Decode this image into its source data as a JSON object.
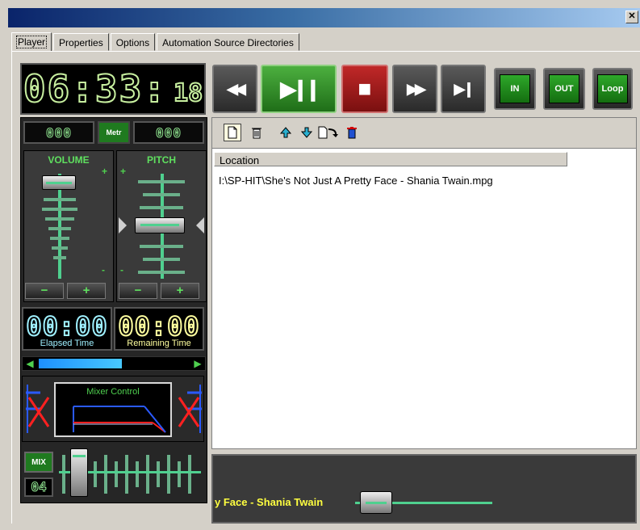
{
  "window": {
    "close_glyph": "✕"
  },
  "tabs": [
    {
      "label": "Player",
      "active": true
    },
    {
      "label": "Properties"
    },
    {
      "label": "Options"
    },
    {
      "label": "Automation Source Directories"
    }
  ],
  "clock": {
    "main": "06:33:",
    "seconds": "18"
  },
  "transport": {
    "rewind": "◀◀",
    "play_pause": "▶❙❙",
    "stop": "■",
    "forward": "▶▶",
    "next": "▶❙",
    "in_label": "IN",
    "out_label": "OUT",
    "loop_label": "Loop"
  },
  "controls": {
    "left_lcd": "000",
    "right_lcd": "000",
    "metr_label": "Metr",
    "volume_label": "VOLUME",
    "pitch_label": "PITCH",
    "volume_minus": "−",
    "volume_plus": "+",
    "pitch_minus": "−",
    "pitch_plus": "+",
    "scale_plus": "+",
    "scale_minus": "-"
  },
  "times": {
    "elapsed_value": "00:00",
    "elapsed_label": "Elapsed Time",
    "remaining_value": "00:00",
    "remaining_label": "Remaining Time"
  },
  "seek": {
    "left": "◀",
    "right": "▶",
    "progress_fraction": 0.55
  },
  "mixer": {
    "title": "Mixer Control",
    "mix_label": "MIX",
    "mix_value": "04"
  },
  "playlist": {
    "column_header": "Location",
    "rows": [
      "I:\\SP-HIT\\She's Not Just A Pretty Face - Shania Twain.mpg"
    ]
  },
  "now_playing": {
    "scroll_text": "y Face - Shania Twain"
  },
  "colors": {
    "lcd_green": "#8fe08f",
    "accent_green": "#4fd04f",
    "transport_red": "#c02828",
    "elapsed_cyan": "#9ff0ff",
    "remaining_yellow": "#ffff9f"
  }
}
